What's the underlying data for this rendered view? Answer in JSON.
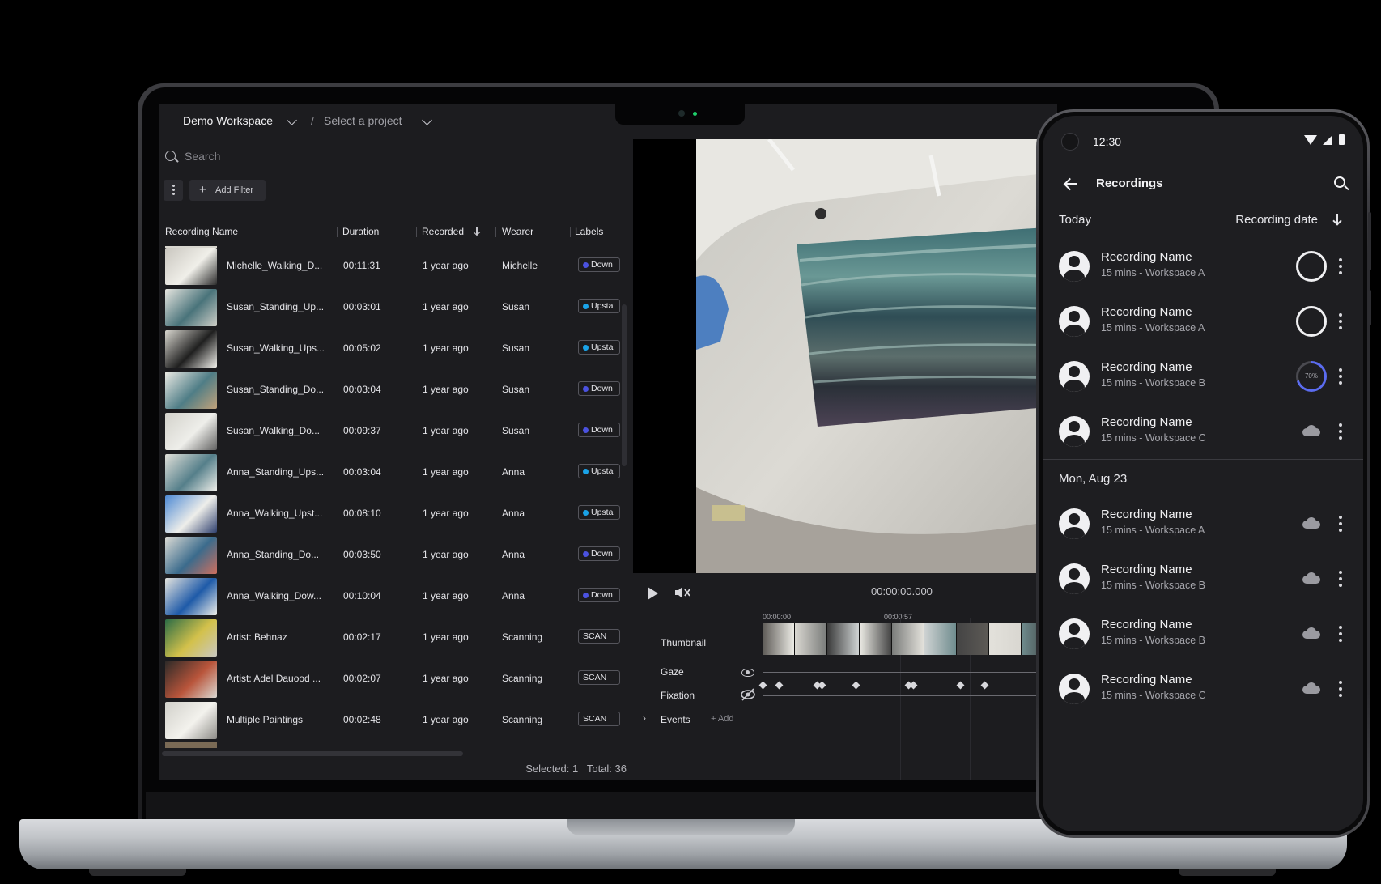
{
  "desktop": {
    "breadcrumb": {
      "workspace": "Demo Workspace",
      "separator": "/",
      "project_placeholder": "Select a project"
    },
    "search": {
      "placeholder": "Search"
    },
    "toolbar": {
      "add_filter": "Add Filter"
    },
    "table": {
      "columns": [
        "Recording Name",
        "Duration",
        "Recorded",
        "Wearer",
        "Labels"
      ],
      "sort_column": "Recorded",
      "sort_direction": "descending",
      "rows": [
        {
          "name": "Michelle_Walking_D...",
          "duration": "00:11:31",
          "recorded": "1 year ago",
          "wearer": "Michelle",
          "label": "Down",
          "label_color": "#4b52e0"
        },
        {
          "name": "Susan_Standing_Up...",
          "duration": "00:03:01",
          "recorded": "1 year ago",
          "wearer": "Susan",
          "label": "Upsta",
          "label_color": "#1aa3e8"
        },
        {
          "name": "Susan_Walking_Ups...",
          "duration": "00:05:02",
          "recorded": "1 year ago",
          "wearer": "Susan",
          "label": "Upsta",
          "label_color": "#1aa3e8"
        },
        {
          "name": "Susan_Standing_Do...",
          "duration": "00:03:04",
          "recorded": "1 year ago",
          "wearer": "Susan",
          "label": "Down",
          "label_color": "#4b52e0"
        },
        {
          "name": "Susan_Walking_Do...",
          "duration": "00:09:37",
          "recorded": "1 year ago",
          "wearer": "Susan",
          "label": "Down",
          "label_color": "#4b52e0"
        },
        {
          "name": "Anna_Standing_Ups...",
          "duration": "00:03:04",
          "recorded": "1 year ago",
          "wearer": "Anna",
          "label": "Upsta",
          "label_color": "#1aa3e8"
        },
        {
          "name": "Anna_Walking_Upst...",
          "duration": "00:08:10",
          "recorded": "1 year ago",
          "wearer": "Anna",
          "label": "Upsta",
          "label_color": "#1aa3e8"
        },
        {
          "name": "Anna_Standing_Do...",
          "duration": "00:03:50",
          "recorded": "1 year ago",
          "wearer": "Anna",
          "label": "Down",
          "label_color": "#4b52e0"
        },
        {
          "name": "Anna_Walking_Dow...",
          "duration": "00:10:04",
          "recorded": "1 year ago",
          "wearer": "Anna",
          "label": "Down",
          "label_color": "#4b52e0"
        },
        {
          "name": "Artist: Behnaz",
          "duration": "00:02:17",
          "recorded": "1 year ago",
          "wearer": "Scanning",
          "label": "SCAN",
          "label_color": ""
        },
        {
          "name": "Artist: Adel Dauood ...",
          "duration": "00:02:07",
          "recorded": "1 year ago",
          "wearer": "Scanning",
          "label": "SCAN",
          "label_color": ""
        },
        {
          "name": "Multiple Paintings",
          "duration": "00:02:48",
          "recorded": "1 year ago",
          "wearer": "Scanning",
          "label": "SCAN",
          "label_color": ""
        }
      ]
    },
    "footer": {
      "selected": "Selected: 1",
      "total": "Total: 36"
    },
    "player": {
      "timecode": "00:00:00.000",
      "ruler": [
        "00:00:00",
        "00:00:57",
        "00"
      ],
      "tracks": {
        "thumbnail": "Thumbnail",
        "gaze": "Gaze",
        "fixation": "Fixation",
        "events": "Events"
      },
      "add_event": "Add"
    }
  },
  "mobile": {
    "status_time": "12:30",
    "title": "Recordings",
    "sort_label": "Recording date",
    "sections": [
      {
        "heading": "Today",
        "items": [
          {
            "name": "Recording Name",
            "meta": "15 mins - Workspace A",
            "status": "pending"
          },
          {
            "name": "Recording Name",
            "meta": "15 mins - Workspace A",
            "status": "pending"
          },
          {
            "name": "Recording Name",
            "meta": "15 mins - Workspace B",
            "status": "uploading",
            "progress_label": "70%",
            "progress": 0.7
          },
          {
            "name": "Recording Name",
            "meta": "15 mins - Workspace C",
            "status": "uploaded"
          }
        ]
      },
      {
        "heading": "Mon, Aug 23",
        "items": [
          {
            "name": "Recording Name",
            "meta": "15 mins - Workspace A",
            "status": "uploaded"
          },
          {
            "name": "Recording Name",
            "meta": "15 mins - Workspace B",
            "status": "uploaded"
          },
          {
            "name": "Recording Name",
            "meta": "15 mins - Workspace B",
            "status": "uploaded"
          },
          {
            "name": "Recording Name",
            "meta": "15 mins - Workspace C",
            "status": "uploaded"
          }
        ]
      }
    ]
  },
  "colors": {
    "accent": "#4b52e0",
    "accent_light": "#1aa3e8",
    "progress": "#5b6cf0",
    "background": "#1c1c1f"
  }
}
